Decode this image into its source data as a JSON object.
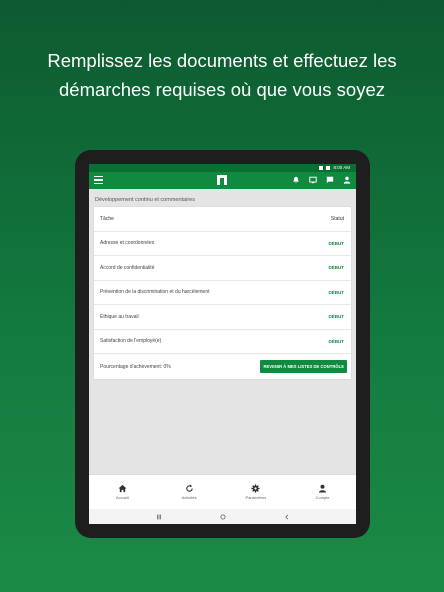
{
  "headline": {
    "line1": "Remplissez les documents et effectuez les",
    "line2": "démarches requises où que vous soyez"
  },
  "statusbar": {
    "time": "8:00 AM"
  },
  "appbar": {
    "icons": [
      "menu-icon",
      "logo-icon",
      "bell-icon",
      "chat-icon",
      "message-icon",
      "person-icon"
    ]
  },
  "page": {
    "title": "Développement continu et commentaires",
    "columns": {
      "task": "Tâche",
      "status": "Statut"
    },
    "tasks": [
      {
        "name": "Adresse et coordonnées",
        "status": "DÉBUT"
      },
      {
        "name": "Accord de confidentialité",
        "status": "DÉBUT"
      },
      {
        "name": "Prévention de la discrimination et du harcèlement",
        "status": "DÉBUT"
      },
      {
        "name": "Éthique au travail",
        "status": "DÉBUT"
      },
      {
        "name": "Satisfaction de l'employé(e)",
        "status": "DÉBUT"
      }
    ],
    "progress_label": "Pourcentage d'achèvement: 0%",
    "back_button": "REVENIR À MES LISTES DE CONTRÔLE"
  },
  "bottom_nav": [
    {
      "label": "Accueil",
      "icon": "home-icon"
    },
    {
      "label": "Activités",
      "icon": "refresh-icon"
    },
    {
      "label": "Paramètres",
      "icon": "gear-icon"
    },
    {
      "label": "Compte",
      "icon": "person-icon"
    }
  ],
  "colors": {
    "brand_green": "#0f8a3e",
    "statusbar_green": "#0a6f32",
    "background_top": "#0d5a30",
    "background_bottom": "#1c8a47"
  }
}
